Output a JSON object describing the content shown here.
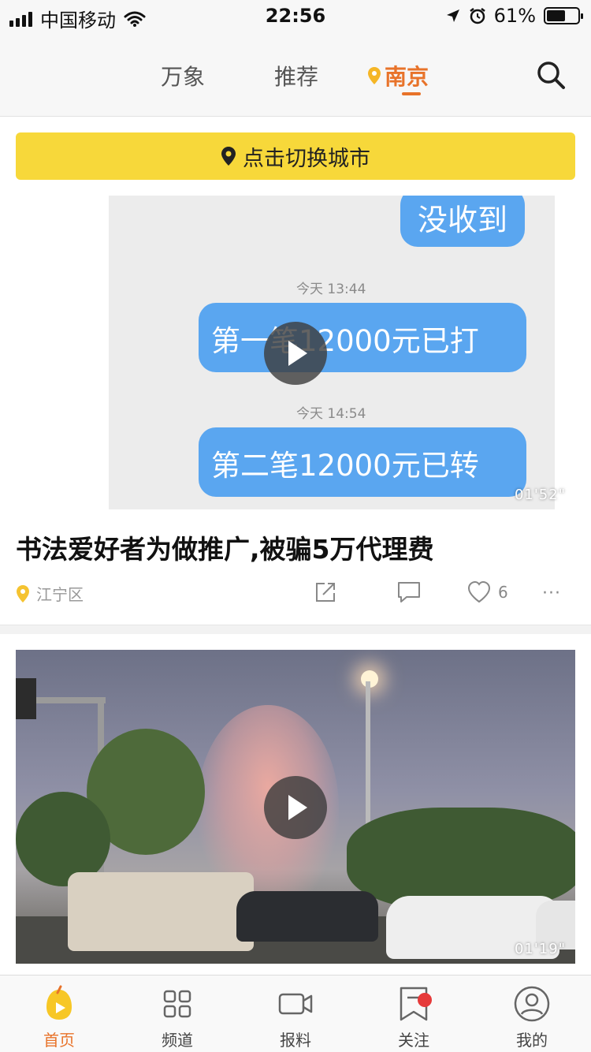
{
  "status_bar": {
    "carrier": "中国移动",
    "time": "22:56",
    "battery_percent": "61%",
    "battery_level": 0.61
  },
  "top_nav": {
    "tabs": [
      {
        "label": "万象",
        "active": false
      },
      {
        "label": "推荐",
        "active": false
      },
      {
        "label": "南京",
        "active": true
      }
    ],
    "search_icon": "search-icon",
    "accent_color": "#e8732a"
  },
  "city_switch": {
    "label": "点击切换城市",
    "bg_color": "#f7d83a"
  },
  "feed": [
    {
      "video_text": {
        "bubble_top": "没收到",
        "time_1": "今天 13:44",
        "bubble_1": "第一笔12000元已打",
        "time_2": "今天 14:54",
        "bubble_2": "第二笔12000元已转"
      },
      "duration": "01'52\"",
      "title": "书法爱好者为做推广,被骗5万代理费",
      "location": "江宁区",
      "likes": "6"
    },
    {
      "duration": "01'19\""
    }
  ],
  "tab_bar": {
    "items": [
      {
        "label": "首页",
        "icon": "home-icon",
        "active": true
      },
      {
        "label": "频道",
        "icon": "grid-icon",
        "active": false
      },
      {
        "label": "报料",
        "icon": "video-camera-icon",
        "active": false
      },
      {
        "label": "关注",
        "icon": "bookmark-icon",
        "active": false,
        "badge": true
      },
      {
        "label": "我的",
        "icon": "user-icon",
        "active": false
      }
    ]
  }
}
